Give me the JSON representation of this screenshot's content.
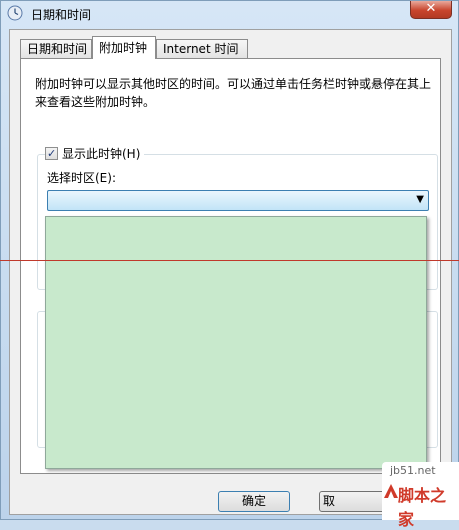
{
  "window": {
    "title": "日期和时间",
    "close_label": "✕"
  },
  "tabs": [
    {
      "label": "日期和时间"
    },
    {
      "label": "附加时钟"
    },
    {
      "label": "Internet 时间"
    }
  ],
  "panel": {
    "description": "附加时钟可以显示其他时区的时间。可以通过单击任务栏时钟或悬停在其上来查看这些附加时钟。",
    "clock1": {
      "checkbox_label": "显示此时钟(H)",
      "checked": true,
      "timezone_label": "选择时区(E):",
      "timezone_value": ""
    }
  },
  "buttons": {
    "ok": "确定",
    "cancel": "取"
  },
  "watermark": {
    "url": "jb51.net",
    "text": "脚本之家"
  },
  "colors": {
    "dropdown_bg": "#c8e9cc",
    "annotation_line": "#c0392b"
  }
}
